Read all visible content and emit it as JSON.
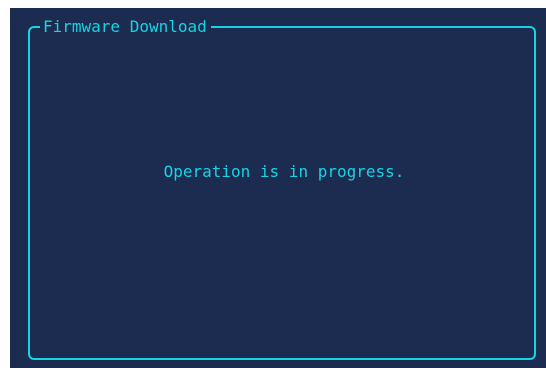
{
  "dialog": {
    "title": "Firmware Download",
    "message": "Operation is in progress."
  },
  "colors": {
    "background": "#1b2c50",
    "accent": "#18d3e3",
    "outer": "#ffffff"
  }
}
